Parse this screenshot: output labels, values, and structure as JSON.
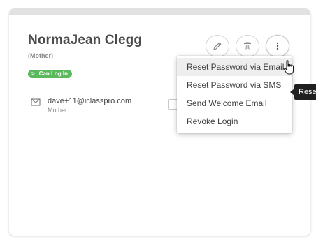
{
  "contact": {
    "name": "NormaJean Clegg",
    "relation_label": "(Mother)",
    "login_badge": "Can Log In",
    "email": "dave+11@iclasspro.com",
    "email_type": "Mother"
  },
  "actions": {
    "edit_icon": "pencil-icon",
    "delete_icon": "trash-icon",
    "more_icon": "more-vertical-icon"
  },
  "menu": {
    "items": [
      "Reset Password via Email",
      "Reset Password via SMS",
      "Send Welcome Email",
      "Revoke Login"
    ]
  },
  "tooltip": {
    "text": "Rese"
  },
  "colors": {
    "badge": "#5cb85c",
    "card_top": "#e2e2e2",
    "tooltip_bg": "#1f1f1f",
    "menu_hover": "#eeeeee"
  }
}
